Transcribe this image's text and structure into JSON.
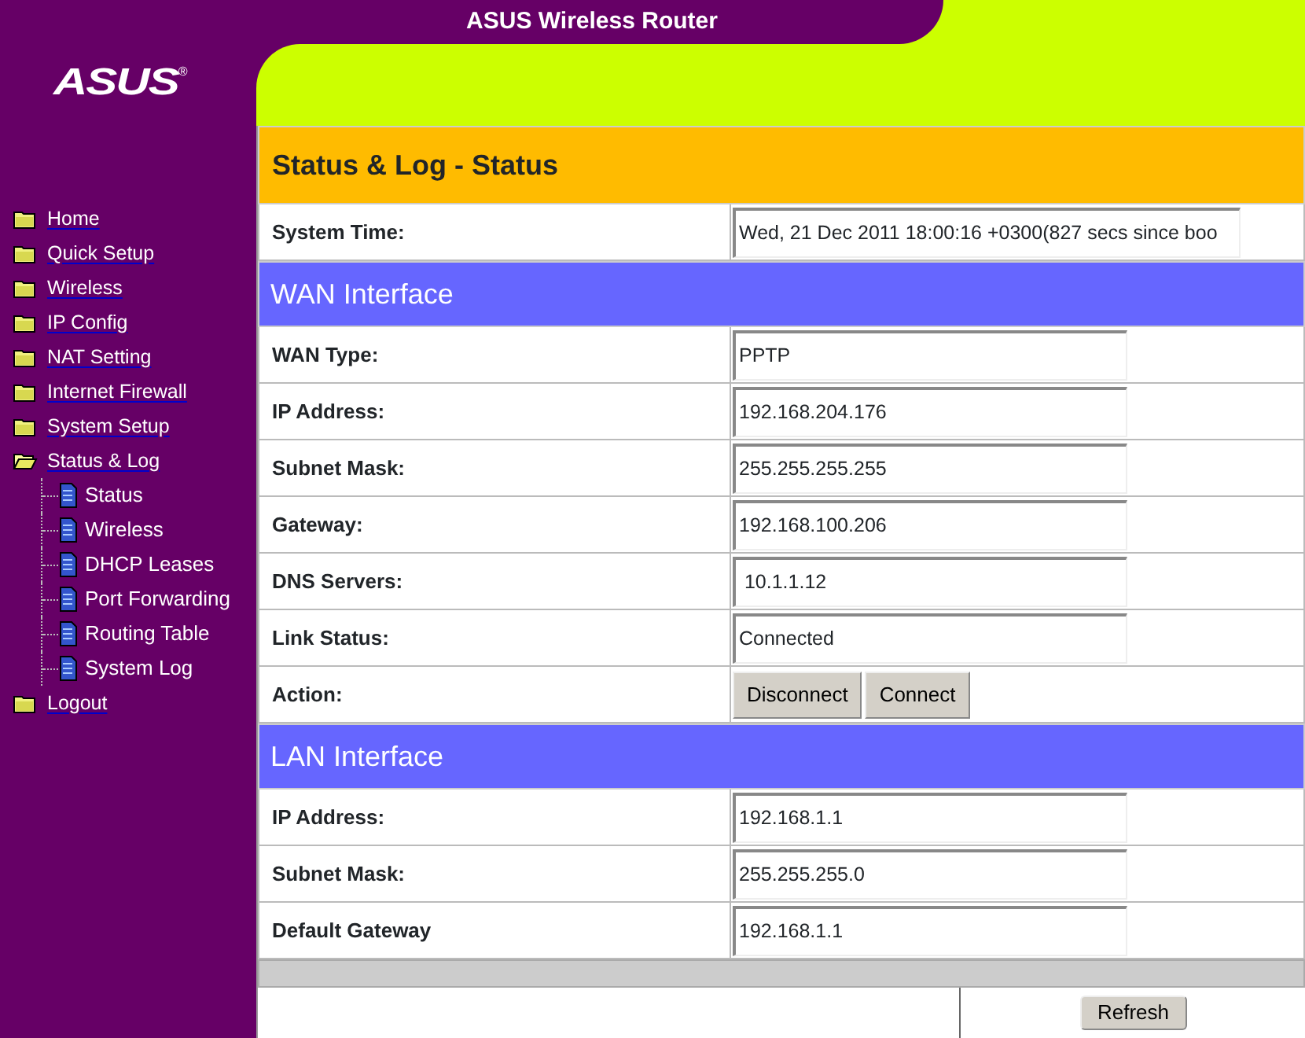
{
  "header": {
    "title": "ASUS Wireless Router",
    "logo": "ASUS",
    "logo_mark": "®"
  },
  "sidebar": {
    "items": [
      {
        "label": "Home",
        "expanded": false
      },
      {
        "label": "Quick Setup",
        "expanded": false
      },
      {
        "label": "Wireless",
        "expanded": false
      },
      {
        "label": "IP Config",
        "expanded": false
      },
      {
        "label": "NAT Setting",
        "expanded": false
      },
      {
        "label": "Internet Firewall",
        "expanded": false
      },
      {
        "label": "System Setup",
        "expanded": false
      },
      {
        "label": "Status & Log",
        "expanded": true,
        "children": [
          {
            "label": "Status"
          },
          {
            "label": "Wireless"
          },
          {
            "label": "DHCP Leases"
          },
          {
            "label": "Port Forwarding"
          },
          {
            "label": "Routing Table"
          },
          {
            "label": "System Log"
          }
        ]
      },
      {
        "label": "Logout",
        "expanded": false
      }
    ]
  },
  "page_title": "Status & Log - Status",
  "sections": [
    {
      "rows": [
        {
          "kind": "wide-field",
          "label": "System Time:",
          "value": "Wed, 21 Dec 2011 18:00:16 +0300(827 secs since boo"
        }
      ]
    },
    {
      "heading": "WAN Interface",
      "rows": [
        {
          "kind": "field",
          "label": "WAN Type:",
          "value": "PPTP"
        },
        {
          "kind": "field",
          "label": "IP Address:",
          "value": "192.168.204.176"
        },
        {
          "kind": "field",
          "label": "Subnet Mask:",
          "value": "255.255.255.255"
        },
        {
          "kind": "field",
          "label": "Gateway:",
          "value": "192.168.100.206"
        },
        {
          "kind": "field",
          "label": "DNS Servers:",
          "value": " 10.1.1.12"
        },
        {
          "kind": "field",
          "label": "Link Status:",
          "value": "Connected"
        },
        {
          "kind": "buttons",
          "label": "Action:",
          "buttons": [
            "Disconnect",
            "Connect"
          ]
        }
      ]
    },
    {
      "heading": "LAN Interface",
      "rows": [
        {
          "kind": "field",
          "label": "IP Address:",
          "value": "192.168.1.1"
        },
        {
          "kind": "field",
          "label": "Subnet Mask:",
          "value": "255.255.255.0"
        },
        {
          "kind": "field",
          "label": "Default Gateway",
          "value": "192.168.1.1"
        }
      ]
    }
  ],
  "footer_button": "Refresh"
}
